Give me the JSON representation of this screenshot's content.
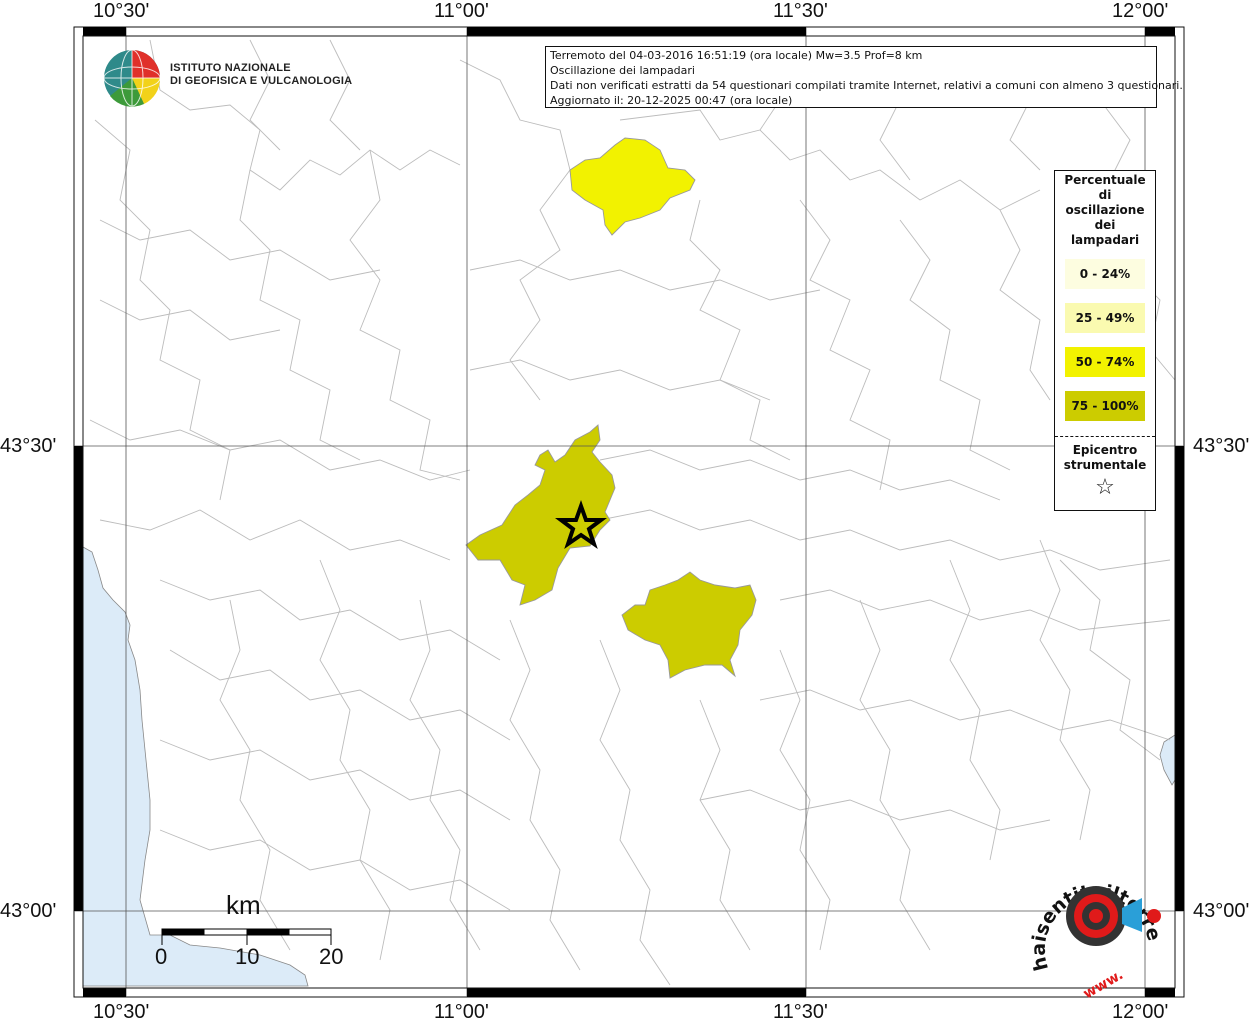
{
  "map": {
    "axis_labels": {
      "lon": [
        "10°30'",
        "11°00'",
        "11°30'",
        "12°00'"
      ],
      "lat": [
        "43°30'",
        "43°00'"
      ]
    },
    "colors": {
      "water": "#dcebf8",
      "class_0_24": "#fdfde0",
      "class_25_49": "#fafab0",
      "class_50_74": "#f2f200",
      "class_75_100": "#cccc00",
      "boundary": "#b8b8b8"
    }
  },
  "institute": {
    "line1": "ISTITUTO NAZIONALE",
    "line2": "DI GEOFISICA E VULCANOLOGIA"
  },
  "info": {
    "line1": "Terremoto del 04-03-2016 16:51:19 (ora locale) Mw=3.5 Prof=8 km",
    "line2": "Oscillazione dei lampadari",
    "line3": "Dati non verificati estratti da 54 questionari compilati tramite Internet, relativi a comuni con almeno 3 questionari.",
    "line4": "Aggiornato il: 20-12-2025 00:47 (ora locale)"
  },
  "legend": {
    "title": [
      "Percentuale",
      "di",
      "oscillazione",
      "dei",
      "lampadari"
    ],
    "classes": [
      {
        "label": "0 - 24%",
        "color": "#fdfde0"
      },
      {
        "label": "25 - 49%",
        "color": "#fafab0"
      },
      {
        "label": "50 - 74%",
        "color": "#f2f200"
      },
      {
        "label": "75 - 100%",
        "color": "#cccc00"
      }
    ],
    "epicenter_title": [
      "Epicentro",
      "strumentale"
    ],
    "epicenter_symbol": "☆"
  },
  "scalebar": {
    "unit": "km",
    "ticks": [
      "0",
      "10",
      "20"
    ]
  },
  "logo": {
    "text": "haisentitoilterremoto.it",
    "prefix": "www."
  }
}
